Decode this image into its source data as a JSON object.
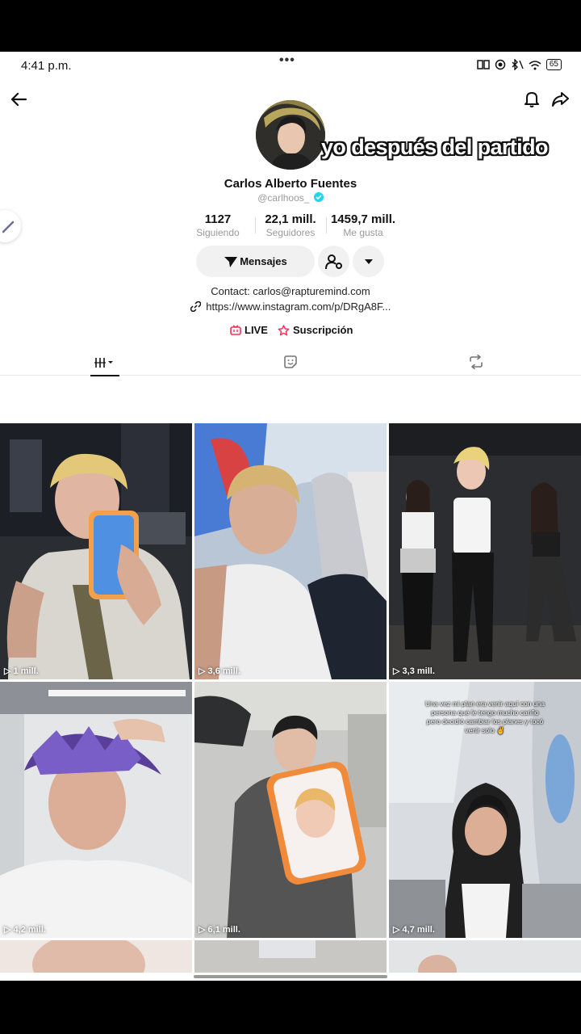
{
  "status": {
    "time": "4:41 p.m.",
    "dots": "•••",
    "battery": "65"
  },
  "profile": {
    "overlay_caption": "yo después del partido",
    "name": "Carlos Alberto Fuentes",
    "handle": "@carlhoos_",
    "stats": [
      {
        "value": "1127",
        "label": "Siguiendo"
      },
      {
        "value": "22,1 mill.",
        "label": "Seguidores"
      },
      {
        "value": "1459,7 mill.",
        "label": "Me gusta"
      }
    ],
    "message_button": "Mensajes",
    "contact": "Contact: carlos@rapturemind.com",
    "link": "https://www.instagram.com/p/DRgA8F...",
    "live_label": "LIVE",
    "subscription_label": "Suscripción"
  },
  "videos": [
    {
      "views": "1 mill."
    },
    {
      "views": "3,6 mill."
    },
    {
      "views": "3,3 mill."
    },
    {
      "views": "4,2 mill."
    },
    {
      "views": "6,1 mill."
    },
    {
      "views": "4,7 mill."
    }
  ],
  "tile6_text": "Una vez mi plan era venir aquí con una persona que le tengo mucho cariño pero decidió cambiar los planes y tocó venir solo ✌️",
  "colors": {
    "verified": "#20d5ec",
    "live": "#fe2c55",
    "text": "#111111",
    "muted": "#9a9a9a"
  }
}
